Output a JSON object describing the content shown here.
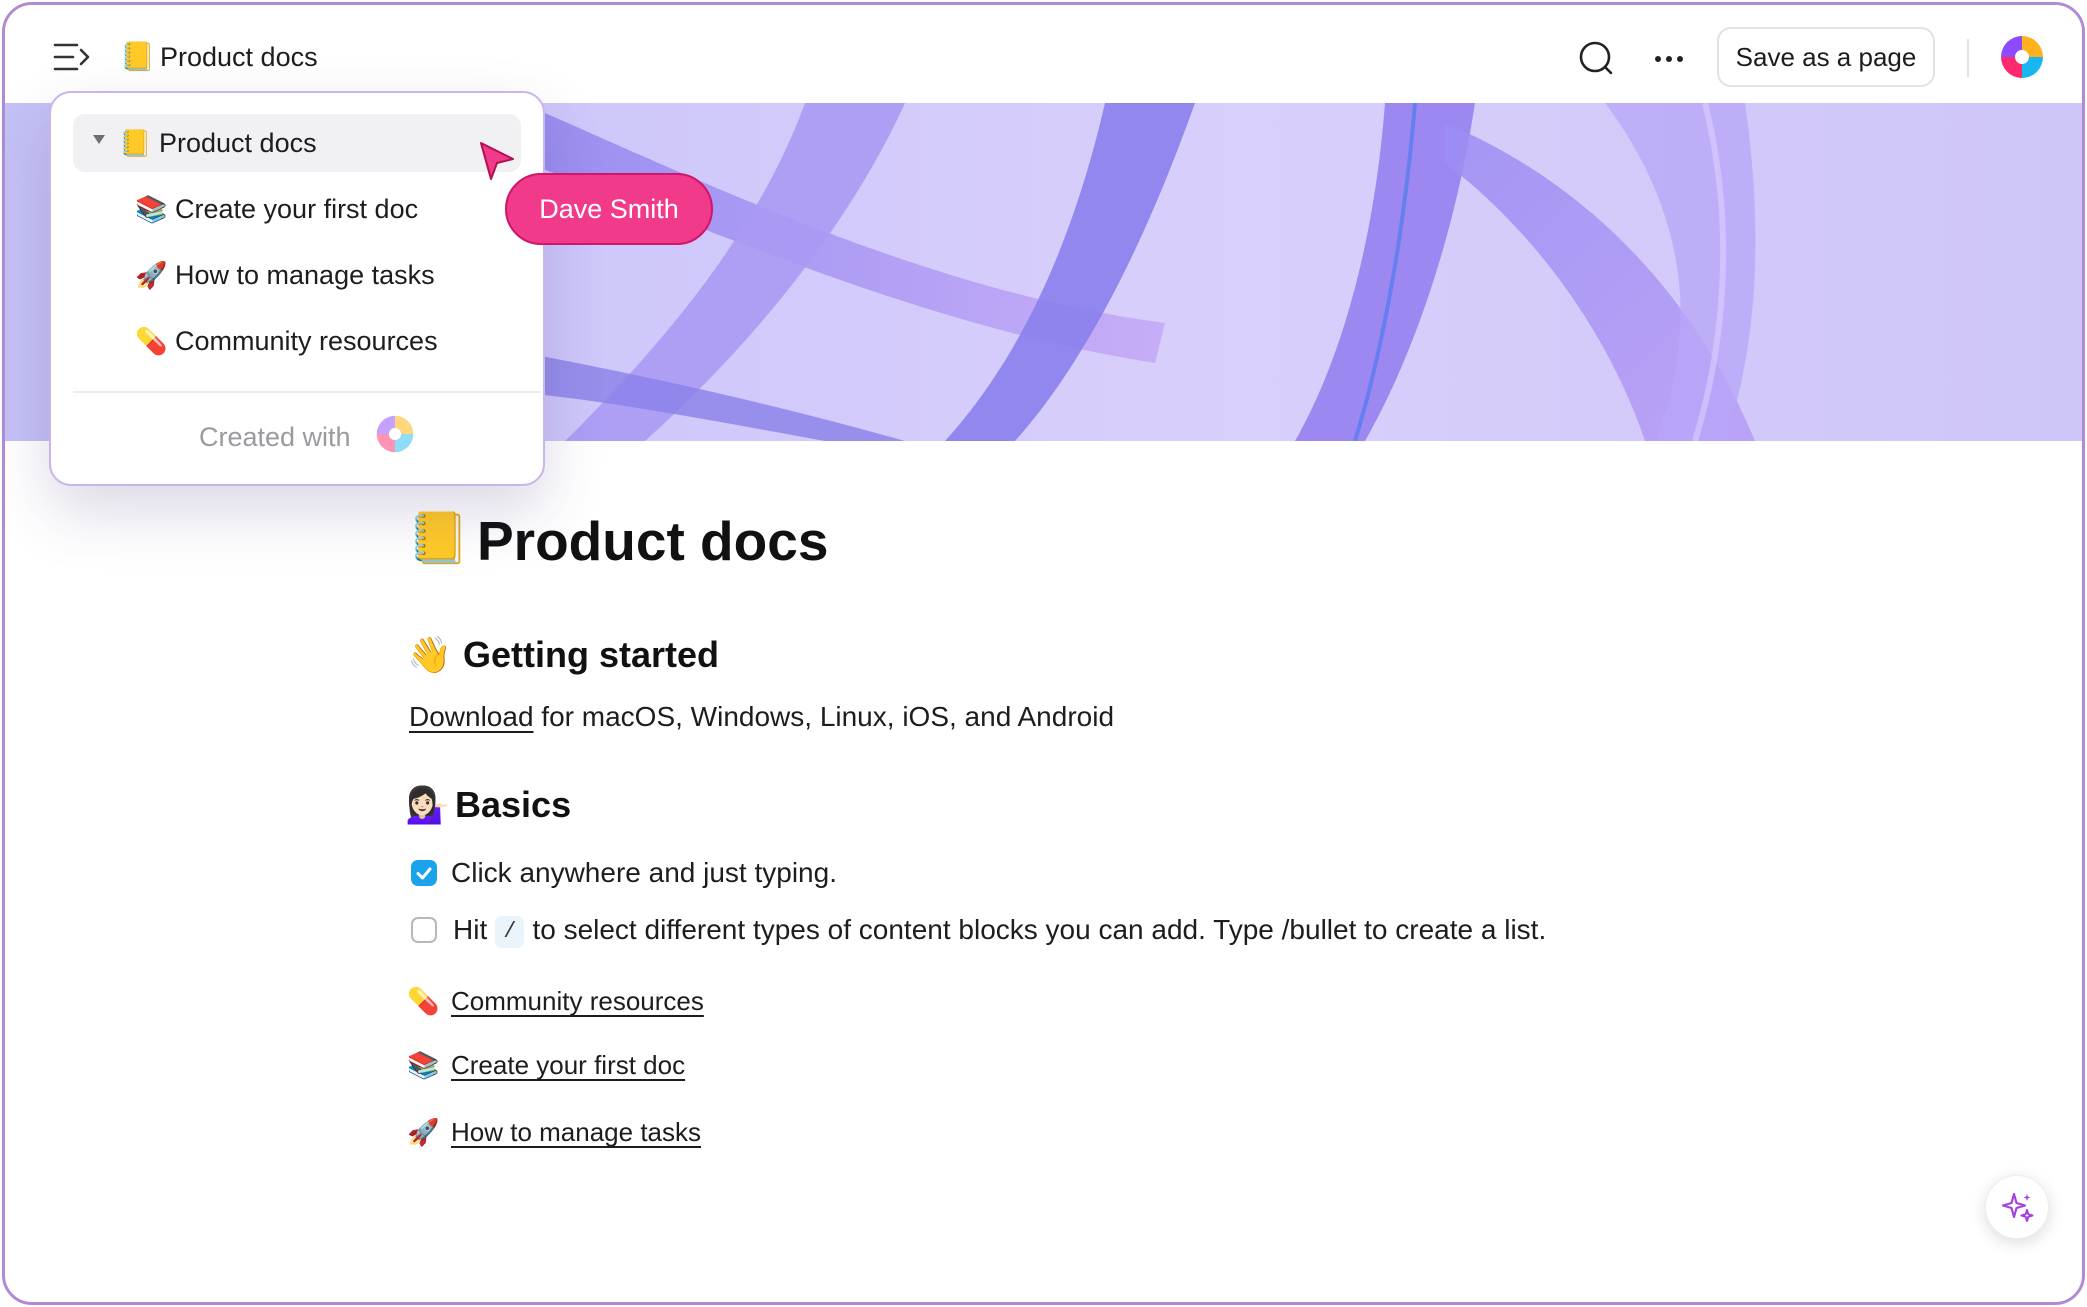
{
  "header": {
    "breadcrumb_emoji": "📒",
    "breadcrumb_title": "Product docs",
    "save_button_label": "Save as a page",
    "icons": [
      "sidebar-toggle-icon",
      "search-icon",
      "more-icon",
      "app-logo"
    ]
  },
  "sidebar": {
    "root": {
      "emoji": "📒",
      "label": "Product docs",
      "expanded": true
    },
    "items": [
      {
        "emoji": "📚",
        "label": "Create your first doc"
      },
      {
        "emoji": "🚀",
        "label": "How to manage tasks"
      },
      {
        "emoji": "💊",
        "label": "Community resources"
      }
    ],
    "footer_text": "Created with"
  },
  "collaborator": {
    "name": "Dave Smith",
    "color": "#f23a8b"
  },
  "document": {
    "title_emoji": "📒",
    "title": "Product docs",
    "sections": [
      {
        "emoji": "👋",
        "heading": "Getting started",
        "paragraph": {
          "link_text": "Download",
          "rest_text": " for macOS, Windows, Linux, iOS, and Android"
        }
      },
      {
        "emoji": "💁🏻‍♀️",
        "heading": "Basics",
        "checklist": [
          {
            "checked": true,
            "text": "Click anywhere and just typing."
          },
          {
            "checked": false,
            "text_before": "Hit",
            "code": "/",
            "text_after": "to select different types of content blocks you can add. Type /bullet to create a list."
          }
        ]
      }
    ],
    "page_links": [
      {
        "emoji": "💊",
        "label": "Community resources"
      },
      {
        "emoji": "📚",
        "label": "Create your first doc"
      },
      {
        "emoji": "🚀",
        "label": "How to manage tasks"
      }
    ]
  },
  "colors": {
    "frame_border": "#b18ad6",
    "checkbox_checked": "#1aa3ea",
    "cursor": "#f23a8b",
    "banner": "#cfc8fb"
  }
}
